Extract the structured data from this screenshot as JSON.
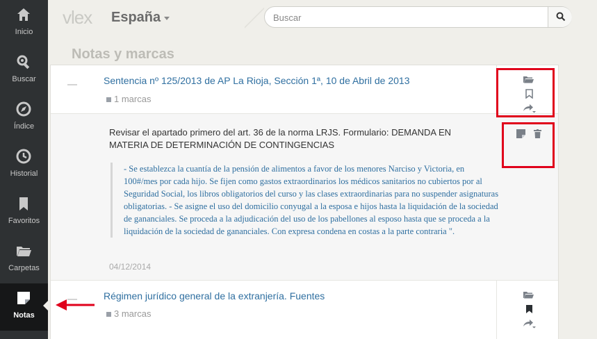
{
  "sidebar": {
    "items": [
      {
        "label": "Inicio",
        "icon": "home-icon"
      },
      {
        "label": "Buscar",
        "icon": "search-gear-icon"
      },
      {
        "label": "Índice",
        "icon": "compass-icon"
      },
      {
        "label": "Historial",
        "icon": "history-icon"
      },
      {
        "label": "Favoritos",
        "icon": "bookmark-icon"
      },
      {
        "label": "Carpetas",
        "icon": "folder-icon"
      },
      {
        "label": "Notas",
        "icon": "note-icon",
        "active": true
      }
    ]
  },
  "header": {
    "logo": "vlex",
    "country": "España",
    "search_placeholder": "Buscar"
  },
  "page": {
    "title": "Notas y marcas"
  },
  "documents": [
    {
      "title": "Sentencia nº 125/2013 de AP La Rioja, Sección 1ª, 10 de Abril de 2013",
      "marks": "1 marcas",
      "note": {
        "text": "Revisar el apartado primero del art. 36 de la norma LRJS. Formulario: DEMANDA EN MATERIA DE DETERMINACIÓN DE CONTINGENCIAS",
        "quote": "- Se establezca la cuantía de la pensión de alimentos a favor de los menores Narciso y Victoria, en 100#/mes por cada hijo. Se fijen como gastos extraordinarios los médicos sanitarios no cubiertos por al Seguridad Social, los libros obligatorios del curso y las clases extraordinarias para no suspender asignaturas obligatorias. - Se asigne el uso del domicilio conyugal a la esposa e hijos hasta la liquidación de la sociedad de gananciales. Se proceda a la adjudicación del uso de los pabellones al esposo hasta que se proceda a la liquidación de la sociedad de gananciales. Con expresa condena en costas a la parte contraria \".",
        "date": "04/12/2014"
      }
    },
    {
      "title": "Régimen jurídico general de la extranjería. Fuentes",
      "marks": "3 marcas"
    }
  ],
  "colors": {
    "sidebar_bg": "#2e3133",
    "link": "#2f6fa0",
    "annotation": "#e0001b"
  }
}
